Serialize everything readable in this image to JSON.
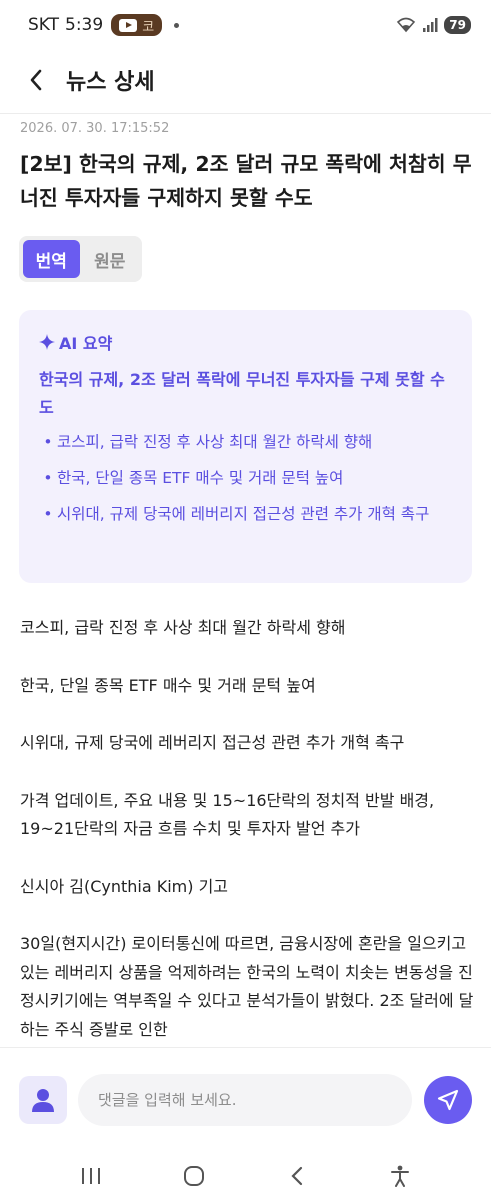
{
  "status_bar": {
    "time": "5:39",
    "carrier": "SKT",
    "notification_text": "코",
    "battery": "79"
  },
  "header": {
    "title": "뉴스 상세"
  },
  "article": {
    "timestamp": "2026. 07. 30. 17:15:52",
    "headline": "[2보] 한국의 규제, 2조 달러 규모 폭락에 처참히 무너진 투자자들 구제하지 못할 수도",
    "paragraphs": [
      "코스피, 급락 진정 후 사상 최대 월간 하락세 향해",
      "한국, 단일 종목 ETF 매수 및 거래 문턱 높여",
      "시위대, 규제 당국에 레버리지 접근성 관련 추가 개혁 촉구",
      "가격 업데이트, 주요 내용 및 15~16단락의 정치적 반발 배경, 19~21단락의 자금 흐름 수치 및 투자자 발언 추가",
      "신시아 김(Cynthia Kim) 기고",
      "30일(현지시간) 로이터통신에 따르면, 금융시장에 혼란을 일으키고 있는 레버리지 상품을 억제하려는 한국의 노력이 치솟는 변동성을 진정시키기에는 역부족일 수 있다고 분석가들이 밝혔다. 2조 달러에 달하는 주식 증발로 인한"
    ]
  },
  "toggle": {
    "translated_label": "번역",
    "original_label": "원문"
  },
  "ai_summary": {
    "title": "AI 요약",
    "headline": "한국의 규제, 2조 달러 폭락에 무너진 투자자들 구제 못할 수도",
    "points": [
      "코스피, 급락 진정 후 사상 최대 월간 하락세 향해",
      "한국, 단일 종목 ETF 매수 및 거래 문턱 높여",
      "시위대, 규제 당국에 레버리지 접근성 관련 추가 개혁 촉구"
    ]
  },
  "comment": {
    "placeholder": "댓글을 입력해 보세요."
  },
  "colors": {
    "accent": "#6a5cf0",
    "ai_text": "#5b4fe0",
    "ai_bg": "#f3f1fd"
  }
}
